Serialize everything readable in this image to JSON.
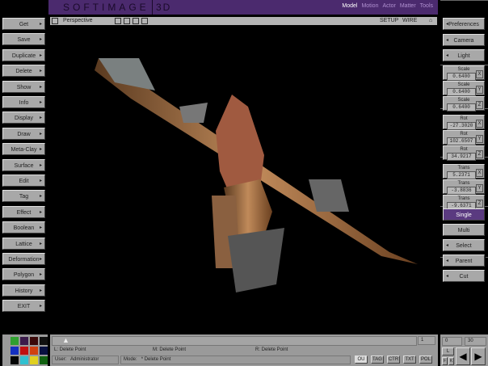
{
  "title": {
    "brand": "SOFTIMAGE",
    "brand_suffix": "3D",
    "modules": [
      "Model",
      "Motion",
      "Actor",
      "Matter",
      "Tools"
    ]
  },
  "viewport": {
    "view": "Perspective",
    "setup": "SETUP",
    "mode": "WIRE"
  },
  "left_menu": [
    "Get",
    "Save",
    "Duplicate",
    "Delete",
    "Show",
    "Info",
    "Display",
    "Draw",
    "Meta-Clay",
    "Surface",
    "Edit",
    "Tag",
    "Effect",
    "Boolean",
    "Lattice",
    "Deformation",
    "Polygon",
    "History",
    "EXIT"
  ],
  "right_menu": {
    "top": [
      "Preferences",
      "Camera",
      "Light"
    ],
    "scale": [
      {
        "label": "Scale",
        "value": "0.6400",
        "axis": "X"
      },
      {
        "label": "Scale",
        "value": "0.6400",
        "axis": "Y"
      },
      {
        "label": "Scale",
        "value": "0.6400",
        "axis": "Z"
      }
    ],
    "rot": [
      {
        "label": "Rot",
        "value": "-27.3020",
        "axis": "X"
      },
      {
        "label": "Rot",
        "value": "102.6507",
        "axis": "Y"
      },
      {
        "label": "Rot",
        "value": "34.9217",
        "axis": "Z"
      }
    ],
    "trans": [
      {
        "label": "Trans",
        "value": "5.2371",
        "axis": "X"
      },
      {
        "label": "Trans",
        "value": "-3.8836",
        "axis": "Y"
      },
      {
        "label": "Trans",
        "value": "-9.6371",
        "axis": "Z"
      }
    ],
    "select_modes": [
      "Single",
      "Multi"
    ],
    "bottom": [
      "Select",
      "Parent",
      "Cut"
    ]
  },
  "bottom": {
    "frame": "1",
    "mouse_left": "L:  Delete Point",
    "mouse_middle": "M:  Delete Point",
    "mouse_right": "R:  Delete Point",
    "user_label": "User:",
    "user": "Administrator",
    "mode_label": "Mode:",
    "mode": "*  Delete Point",
    "toggles": [
      "OU",
      "TAG",
      "CTR",
      "TXT",
      "POL"
    ],
    "start_frame": "0",
    "end_frame": "30",
    "l_btn": "L",
    "f_btn": "F",
    "k_btn": "K"
  },
  "colors": {
    "accent": "#4b2a6e",
    "palette": [
      "#2fa02f",
      "#3a1a4a",
      "#3a0808",
      "#101010",
      "#1530c0",
      "#c01010",
      "#d04010",
      "#081040",
      "#050505",
      "#30c0d0",
      "#e0d020",
      "#106010"
    ]
  }
}
